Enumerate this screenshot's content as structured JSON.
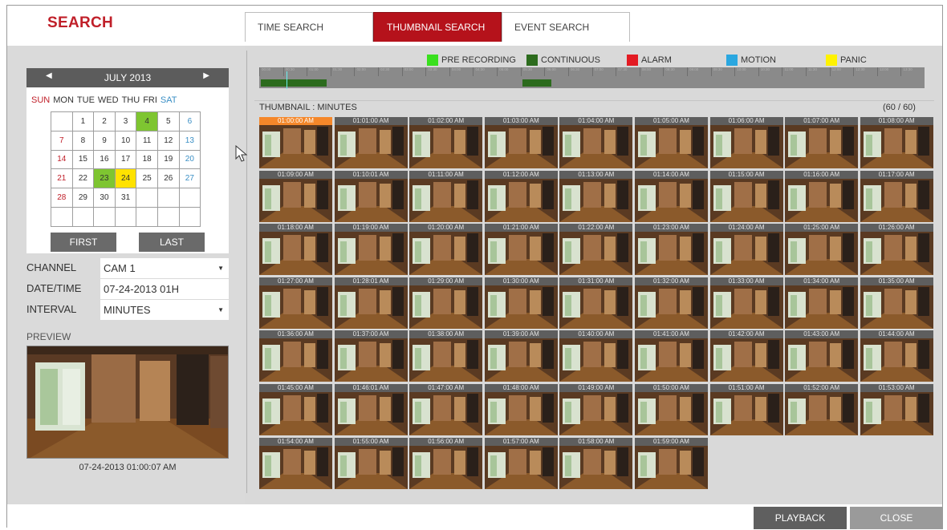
{
  "app": {
    "title": "SEARCH"
  },
  "tabs": [
    {
      "label": "TIME SEARCH",
      "active": false
    },
    {
      "label": "THUMBNAIL SEARCH",
      "active": true
    },
    {
      "label": "EVENT SEARCH",
      "active": false
    }
  ],
  "calendar": {
    "month_label": "JULY 2013",
    "weekdays": [
      "SUN",
      "MON",
      "TUE",
      "WED",
      "THU",
      "FRI",
      "SAT"
    ],
    "weeks": [
      [
        "",
        "1",
        "2",
        "3",
        "4",
        "5",
        "6"
      ],
      [
        "7",
        "8",
        "9",
        "10",
        "11",
        "12",
        "13"
      ],
      [
        "14",
        "15",
        "16",
        "17",
        "18",
        "19",
        "20"
      ],
      [
        "21",
        "22",
        "23",
        "24",
        "25",
        "26",
        "27"
      ],
      [
        "28",
        "29",
        "30",
        "31",
        "",
        "",
        ""
      ],
      [
        "",
        "",
        "",
        "",
        "",
        "",
        ""
      ]
    ],
    "highlight_green": [
      "4",
      "23"
    ],
    "highlight_yellow": [
      "24"
    ],
    "first_label": "FIRST",
    "last_label": "LAST"
  },
  "form": {
    "channel_label": "CHANNEL",
    "channel_value": "CAM 1",
    "datetime_label": "DATE/TIME",
    "datetime_value": "07-24-2013  01H",
    "interval_label": "INTERVAL",
    "interval_value": "MINUTES"
  },
  "preview": {
    "label": "PREVIEW",
    "timestamp": "07-24-2013  01:00:07 AM"
  },
  "legend": [
    {
      "label": "PRE RECORDING",
      "color": "#39e01e"
    },
    {
      "label": "CONTINUOUS",
      "color": "#2c6b1d"
    },
    {
      "label": "ALARM",
      "color": "#e31b23"
    },
    {
      "label": "MOTION",
      "color": "#2aa7e0"
    },
    {
      "label": "PANIC",
      "color": "#fff200"
    }
  ],
  "timeline": {
    "hours": [
      "00:00",
      "00:30",
      "01:00",
      "01:30",
      "02:00",
      "02:30",
      "03:00",
      "03:30",
      "04:00",
      "04:30",
      "05:00",
      "05:30",
      "06:00",
      "06:30",
      "07:00",
      "07:30",
      "08:00",
      "08:30",
      "09:00",
      "09:30",
      "10:00",
      "10:30",
      "11:00",
      "11:30",
      "12:00",
      "12:30",
      "13:00",
      "13:30"
    ]
  },
  "thumbnails": {
    "title": "THUMBNAIL : MINUTES",
    "count": "(60 / 60)",
    "items": [
      "01:00:00 AM",
      "01:01:00 AM",
      "01:02:00 AM",
      "01:03:00 AM",
      "01:04:00 AM",
      "01:05:00 AM",
      "01:06:00 AM",
      "01:07:00 AM",
      "01:08:00 AM",
      "01:09:00 AM",
      "01:10:01 AM",
      "01:11:00 AM",
      "01:12:00 AM",
      "01:13:00 AM",
      "01:14:00 AM",
      "01:15:00 AM",
      "01:16:00 AM",
      "01:17:00 AM",
      "01:18:00 AM",
      "01:19:00 AM",
      "01:20:00 AM",
      "01:21:00 AM",
      "01:22:00 AM",
      "01:23:00 AM",
      "01:24:00 AM",
      "01:25:00 AM",
      "01:26:00 AM",
      "01:27:00 AM",
      "01:28:01 AM",
      "01:29:00 AM",
      "01:30:00 AM",
      "01:31:00 AM",
      "01:32:00 AM",
      "01:33:00 AM",
      "01:34:00 AM",
      "01:35:00 AM",
      "01:36:00 AM",
      "01:37:00 AM",
      "01:38:00 AM",
      "01:39:00 AM",
      "01:40:00 AM",
      "01:41:00 AM",
      "01:42:00 AM",
      "01:43:00 AM",
      "01:44:00 AM",
      "01:45:00 AM",
      "01:46:01 AM",
      "01:47:00 AM",
      "01:48:00 AM",
      "01:49:00 AM",
      "01:50:00 AM",
      "01:51:00 AM",
      "01:52:00 AM",
      "01:53:00 AM",
      "01:54:00 AM",
      "01:55:00 AM",
      "01:56:00 AM",
      "01:57:00 AM",
      "01:58:00 AM",
      "01:59:00 AM"
    ],
    "selected_index": 0
  },
  "buttons": {
    "playback": "PLAYBACK",
    "close": "CLOSE"
  },
  "icons": {
    "prev_month": "chevron-left-icon",
    "next_month": "chevron-right-icon",
    "dropdown": "chevron-down-icon",
    "cursor": "mouse-pointer-icon"
  }
}
